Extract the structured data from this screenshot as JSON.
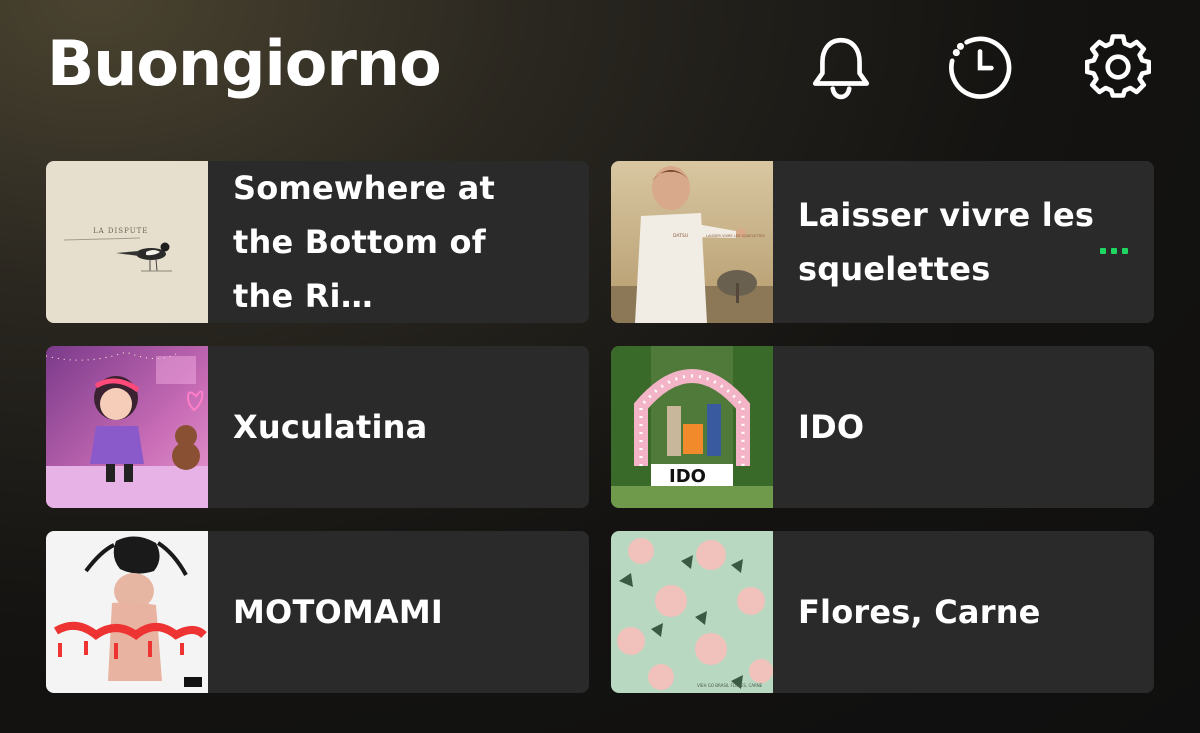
{
  "header": {
    "greeting": "Buongiorno",
    "icons": [
      "bell-icon",
      "recently-played-icon",
      "settings-icon"
    ]
  },
  "cards": [
    {
      "title": "Somewhere at the Bottom of the Ri…",
      "cover_text": "LA DISPUTE"
    },
    {
      "title": "Laisser vivre les squelettes",
      "cover_text": "LAISSER VIVRE LES SQUELETTES",
      "cover_artist": "DATSU",
      "has_more_menu": true
    },
    {
      "title": "Xuculatina"
    },
    {
      "title": "IDO"
    },
    {
      "title": "MOTOMAMI"
    },
    {
      "title": "Flores, Carne",
      "cover_text": "VIEH GO BRASIL FLORES, CARNE"
    }
  ],
  "colors": {
    "accent": "#1ed760",
    "card_bg": "#2a2a2a"
  }
}
